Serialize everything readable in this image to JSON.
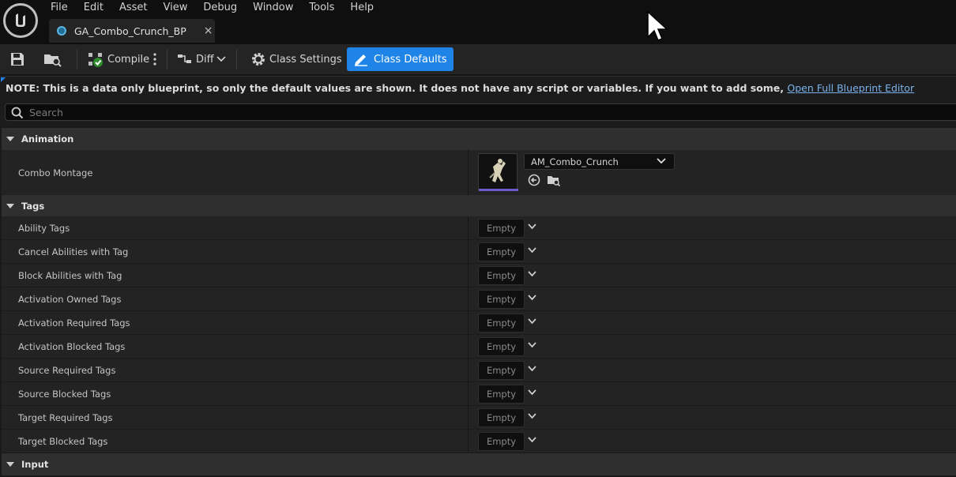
{
  "menu": [
    "File",
    "Edit",
    "Asset",
    "View",
    "Debug",
    "Window",
    "Tools",
    "Help"
  ],
  "document_tab": {
    "title": "GA_Combo_Crunch_BP",
    "close": "×"
  },
  "toolbar": {
    "compile_label": "Compile",
    "diff_label": "Diff",
    "class_settings_label": "Class Settings",
    "class_defaults_label": "Class Defaults"
  },
  "notice": {
    "text": "NOTE: This is a data only blueprint, so only the default values are shown.  It does not have any script or variables.  If you want to add some,",
    "link": "Open Full Blueprint Editor"
  },
  "search": {
    "placeholder": "Search"
  },
  "categories": {
    "animation": "Animation",
    "tags": "Tags",
    "input": "Input"
  },
  "animation": {
    "combo_montage_label": "Combo Montage",
    "combo_montage_value": "AM_Combo_Crunch"
  },
  "tags": {
    "empty_label": "Empty",
    "rows": [
      "Ability Tags",
      "Cancel Abilities with Tag",
      "Block Abilities with Tag",
      "Activation Owned Tags",
      "Activation Required Tags",
      "Activation Blocked Tags",
      "Source Required Tags",
      "Source Blocked Tags",
      "Target Required Tags",
      "Target Blocked Tags"
    ]
  },
  "colors": {
    "accent": "#1e84e8",
    "link": "#7ab3ee",
    "montage_bar": "#6d5acb"
  }
}
